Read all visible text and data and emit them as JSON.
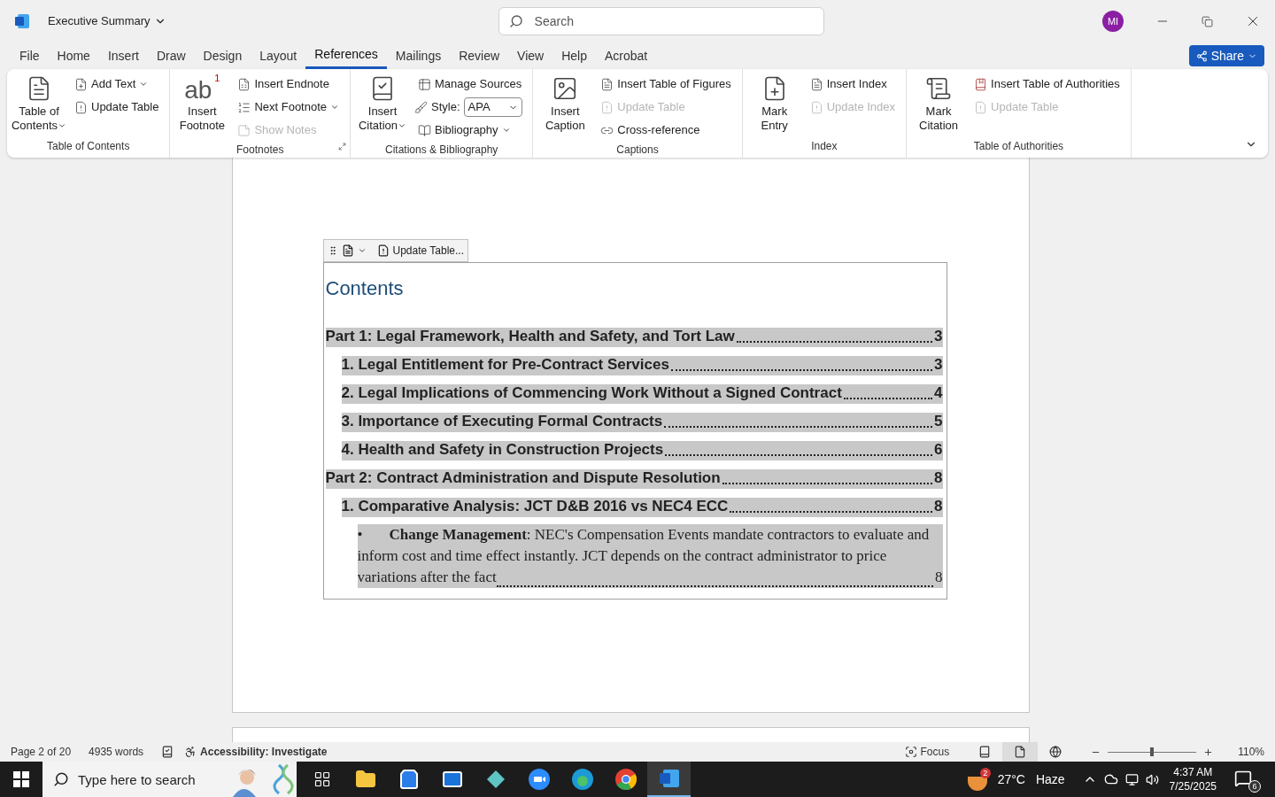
{
  "title_bar": {
    "document_title": "Executive Summary",
    "search": {
      "placeholder": "Search"
    },
    "avatar": "MI"
  },
  "tabs": [
    {
      "label": "File",
      "selected": false
    },
    {
      "label": "Home",
      "selected": false
    },
    {
      "label": "Insert",
      "selected": false
    },
    {
      "label": "Draw",
      "selected": false
    },
    {
      "label": "Design",
      "selected": false
    },
    {
      "label": "Layout",
      "selected": false
    },
    {
      "label": "References",
      "selected": true
    },
    {
      "label": "Mailings",
      "selected": false
    },
    {
      "label": "Review",
      "selected": false
    },
    {
      "label": "View",
      "selected": false
    },
    {
      "label": "Help",
      "selected": false
    },
    {
      "label": "Acrobat",
      "selected": false
    }
  ],
  "share_button": "Share",
  "ribbon_groups": [
    {
      "label": "Table of Contents",
      "launcher": false,
      "items": [
        {
          "kind": "large",
          "lines": [
            "Table of",
            "Contents"
          ],
          "dropdown": true,
          "disabled": false
        },
        {
          "kind": "stack",
          "items": [
            {
              "label": "Add Text",
              "dropdown": true,
              "disabled": false
            },
            {
              "label": "Update Table",
              "dropdown": false,
              "disabled": false
            }
          ]
        }
      ]
    },
    {
      "label": "Footnotes",
      "launcher": true,
      "items": [
        {
          "kind": "large",
          "glyph": "ab",
          "superscript": "1",
          "lines": [
            "Insert",
            "Footnote"
          ],
          "dropdown": false,
          "disabled": false
        },
        {
          "kind": "stack",
          "items": [
            {
              "label": "Insert Endnote",
              "dropdown": false,
              "disabled": false
            },
            {
              "label": "Next Footnote",
              "dropdown": true,
              "disabled": false
            },
            {
              "label": "Show Notes",
              "dropdown": false,
              "disabled": true
            }
          ]
        }
      ]
    },
    {
      "label": "Citations & Bibliography",
      "launcher": false,
      "items": [
        {
          "kind": "large",
          "lines": [
            "Insert",
            "Citation"
          ],
          "dropdown": true,
          "disabled": false
        },
        {
          "kind": "stack",
          "items": [
            {
              "label": "Manage Sources",
              "dropdown": false,
              "disabled": false
            },
            {
              "label": "Style:",
              "select": "APA"
            },
            {
              "label": "Bibliography",
              "dropdown": true,
              "disabled": false
            }
          ]
        }
      ]
    },
    {
      "label": "Captions",
      "launcher": false,
      "items": [
        {
          "kind": "large",
          "lines": [
            "Insert",
            "Caption"
          ],
          "dropdown": false,
          "disabled": false
        },
        {
          "kind": "stack",
          "items": [
            {
              "label": "Insert Table of Figures",
              "dropdown": false,
              "disabled": false
            },
            {
              "label": "Update Table",
              "dropdown": false,
              "disabled": true
            },
            {
              "label": "Cross-reference",
              "dropdown": false,
              "disabled": false
            }
          ]
        }
      ]
    },
    {
      "label": "Index",
      "launcher": false,
      "items": [
        {
          "kind": "large",
          "lines": [
            "Mark",
            "Entry"
          ],
          "dropdown": false,
          "disabled": false
        },
        {
          "kind": "stack",
          "items": [
            {
              "label": "Insert Index",
              "dropdown": false,
              "disabled": false
            },
            {
              "label": "Update Index",
              "dropdown": false,
              "disabled": true
            }
          ]
        }
      ]
    },
    {
      "label": "Table of Authorities",
      "launcher": false,
      "items": [
        {
          "kind": "large",
          "lines": [
            "Mark",
            "Citation"
          ],
          "dropdown": false,
          "disabled": false
        },
        {
          "kind": "stack",
          "items": [
            {
              "label": "Insert Table of Authorities",
              "dropdown": false,
              "disabled": false
            },
            {
              "label": "Update Table",
              "dropdown": false,
              "disabled": true
            }
          ]
        }
      ]
    }
  ],
  "toc_control": {
    "update_button": "Update Table..."
  },
  "toc": {
    "title": "Contents",
    "entries": [
      {
        "kind": "heading",
        "text": "Part 1: Legal Framework, Health and Safety, and Tort Law",
        "page": "3",
        "children": [
          {
            "kind": "heading",
            "text": "1. Legal Entitlement for Pre-Contract Services",
            "page": "3"
          },
          {
            "kind": "heading",
            "text": "2. Legal Implications of Commencing Work Without a Signed Contract",
            "page": "4"
          },
          {
            "kind": "heading",
            "text": "3. Importance of Executing Formal Contracts",
            "page": "5"
          },
          {
            "kind": "heading",
            "text": "4. Health and Safety in Construction Projects",
            "page": "6"
          }
        ]
      },
      {
        "kind": "heading",
        "text": "Part 2: Contract Administration and Dispute Resolution",
        "page": "8",
        "children": [
          {
            "kind": "heading",
            "text": "1. Comparative Analysis: JCT D&B 2016 vs NEC4 ECC",
            "page": "8",
            "children": [
              {
                "kind": "bullet",
                "bullet": "•",
                "text": "**Change Management**: NEC's Compensation Events mandate contractors to evaluate and inform cost and time effect instantly. JCT depends on the contract administrator to price variations after the fact",
                "page": "8"
              }
            ]
          }
        ]
      }
    ]
  },
  "status_bar": {
    "page": "Page 2 of 20",
    "words": "4935 words",
    "accessibility": "Accessibility: Investigate",
    "focus": "Focus",
    "views": [
      {
        "kind": "read",
        "selected": false
      },
      {
        "kind": "print",
        "selected": true
      },
      {
        "kind": "web",
        "selected": false
      }
    ],
    "zoom": {
      "level": 0.5,
      "reading": "110%"
    }
  },
  "taskbar": {
    "search": {
      "placeholder": "Type here to search"
    },
    "apps": [
      {
        "kind": "taskview",
        "selected": false
      },
      {
        "kind": "explorer",
        "selected": false
      },
      {
        "kind": "store",
        "selected": false
      },
      {
        "kind": "mail",
        "selected": false
      },
      {
        "kind": "diamond",
        "selected": false
      },
      {
        "kind": "zoom",
        "selected": false
      },
      {
        "kind": "edge",
        "selected": false
      },
      {
        "kind": "chrome",
        "selected": false
      },
      {
        "kind": "word",
        "selected": true
      }
    ],
    "weather": {
      "badge": "2",
      "temperature": "27°C",
      "condition": "Haze"
    },
    "time": "4:37 AM",
    "date": "7/25/2025",
    "notifications": "6"
  }
}
